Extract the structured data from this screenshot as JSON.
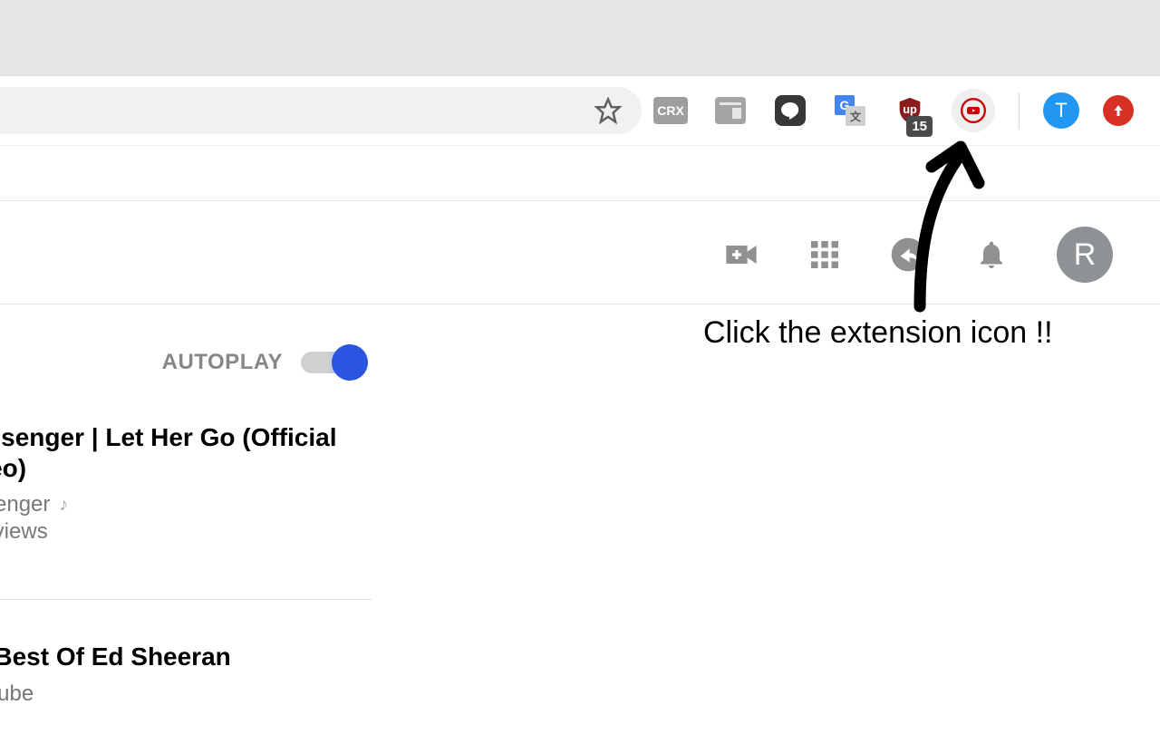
{
  "toolbar": {
    "extensions": {
      "crx_label": "CRX",
      "line_label": "LINE",
      "gtranslate_a": "G",
      "gtranslate_b": "文",
      "ublock_label": "up",
      "ublock_badge": "15"
    },
    "profile_letter": "T"
  },
  "youtube": {
    "avatar_letter": "R"
  },
  "annotation": "Click the extension icon !!",
  "autoplay": {
    "label": "AUTOPLAY",
    "on": true
  },
  "related": [
    {
      "title": "assenger | Let Her Go (Official deo)",
      "channel": "ssenger",
      "music": true,
      "meta": "B views"
    },
    {
      "title": "e Best Of Ed Sheeran",
      "channel": "uTube",
      "music": false,
      "meta": ""
    }
  ]
}
